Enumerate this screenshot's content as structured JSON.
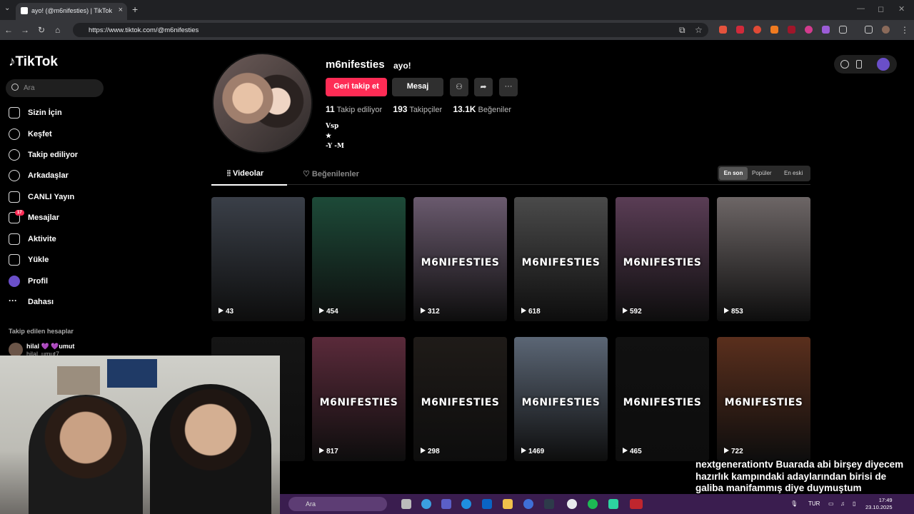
{
  "browser": {
    "tab_title": "ayo! (@m6nifesties) | TikTok",
    "url": "https://www.tiktok.com/@m6nifesties"
  },
  "sidebar": {
    "logo": "TikTok",
    "search_placeholder": "Ara",
    "items": [
      {
        "label": "Sizin İçin",
        "icon": "home-icon"
      },
      {
        "label": "Keşfet",
        "icon": "compass-icon"
      },
      {
        "label": "Takip ediliyor",
        "icon": "following-icon"
      },
      {
        "label": "Arkadaşlar",
        "icon": "friends-icon"
      },
      {
        "label": "CANLI Yayın",
        "icon": "live-icon"
      },
      {
        "label": "Mesajlar",
        "icon": "messages-icon",
        "badge": "17"
      },
      {
        "label": "Aktivite",
        "icon": "activity-icon"
      },
      {
        "label": "Yükle",
        "icon": "upload-icon"
      },
      {
        "label": "Profil",
        "icon": "profile-icon"
      },
      {
        "label": "Dahası",
        "icon": "more-icon"
      }
    ],
    "followed_title": "Takip edilen hesaplar",
    "followed_account": "hilal 💜 💜umut",
    "followed_handle": "hilal_umut7"
  },
  "profile": {
    "username": "m6nifesties",
    "nickname": "ayo!",
    "follow_button": "Geri takip et",
    "message_button": "Mesaj",
    "following_count": "11",
    "following_label": "Takip ediliyor",
    "followers_count": "193",
    "followers_label": "Takipçiler",
    "likes_count": "13.1K",
    "likes_label": "Beğeniler",
    "bio": [
      "Vsp",
      "★",
      "-Y -M"
    ]
  },
  "tabs": {
    "videos": "Videolar",
    "liked": "Beğenilenler"
  },
  "sort": {
    "latest": "En son",
    "popular": "Popüler",
    "oldest": "En eski"
  },
  "videos": [
    {
      "views": "43",
      "brand": "",
      "bg": "#3a3f48"
    },
    {
      "views": "454",
      "brand": "",
      "bg": "#1d4a38"
    },
    {
      "views": "312",
      "brand": "M6NIFESTIES",
      "bg": "#6a5a6e"
    },
    {
      "views": "618",
      "brand": "M6NIFESTIES",
      "bg": "#4a4a4a"
    },
    {
      "views": "592",
      "brand": "M6NIFESTIES",
      "bg": "#5a3d55"
    },
    {
      "views": "853",
      "brand": "",
      "bg": "#6d6666"
    },
    {
      "views": "",
      "brand": "",
      "bg": "#151515"
    },
    {
      "views": "817",
      "brand": "M6NIFESTIES",
      "bg": "#5a2a3a"
    },
    {
      "views": "298",
      "brand": "M6NIFESTIES",
      "bg": "#1f1b18"
    },
    {
      "views": "1469",
      "brand": "M6NIFESTIES",
      "bg": "#5b6675"
    },
    {
      "views": "465",
      "brand": "M6NIFESTIES",
      "bg": "#111"
    },
    {
      "views": "722",
      "brand": "M6NIFESTIES",
      "bg": "#5a2f1d"
    }
  ],
  "taskbar": {
    "search": "Ara",
    "lang": "TUR",
    "time": "17:49",
    "date": "23.10.2025"
  },
  "chat": {
    "user": "nextgenerationtv",
    "message": "Buarada abi birşey diyecem hazırlık kampındaki adaylarından birisi de galiba manifammış diye duymuştum"
  }
}
